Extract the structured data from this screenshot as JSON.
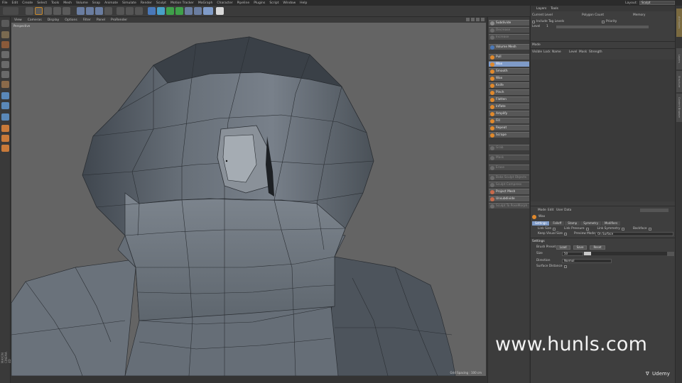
{
  "menubar": {
    "items": [
      "File",
      "Edit",
      "Create",
      "Select",
      "Tools",
      "Mesh",
      "Volume",
      "Snap",
      "Animate",
      "Simulate",
      "Render",
      "Sculpt",
      "Motion Tracker",
      "MoGraph",
      "Character",
      "Pipeline",
      "Plugins",
      "Script",
      "Window",
      "Help"
    ],
    "layout_label": "Layout:",
    "layout_value": "Sculpt"
  },
  "viewport": {
    "menu": [
      "View",
      "Cameras",
      "Display",
      "Options",
      "Filter",
      "Panel",
      "ProRender"
    ],
    "label": "Perspective",
    "grid_spacing": "Grid Spacing : 100 cm"
  },
  "sculpt_palette": {
    "top_items": [
      {
        "label": "Subdivide",
        "state": "normal",
        "icon": "subdivide-icon"
      },
      {
        "label": "Decrease",
        "state": "disabled",
        "icon": "decrease-icon"
      },
      {
        "label": "Increase",
        "state": "disabled",
        "icon": "increase-icon"
      },
      {
        "label": "Volume Mesh",
        "state": "normal",
        "icon": "volume-mesh-icon"
      }
    ],
    "brushes": [
      {
        "label": "Pull",
        "state": "normal",
        "color": "#e0892c"
      },
      {
        "label": "Wax",
        "state": "active",
        "color": "#e0892c"
      },
      {
        "label": "Smooth",
        "state": "normal",
        "color": "#e0892c"
      },
      {
        "label": "Wax",
        "state": "normal",
        "color": "#e0892c"
      },
      {
        "label": "Knife",
        "state": "normal",
        "color": "#e0892c"
      },
      {
        "label": "Pinch",
        "state": "normal",
        "color": "#e0892c"
      },
      {
        "label": "Flatten",
        "state": "normal",
        "color": "#e0892c"
      },
      {
        "label": "Inflate",
        "state": "normal",
        "color": "#e0892c"
      },
      {
        "label": "Amplify",
        "state": "normal",
        "color": "#e0892c"
      },
      {
        "label": "Fill",
        "state": "normal",
        "color": "#e0892c"
      },
      {
        "label": "Repeat",
        "state": "normal",
        "color": "#e0892c"
      },
      {
        "label": "Scrape",
        "state": "normal",
        "color": "#e0892c"
      }
    ],
    "lower_items": [
      {
        "label": "Grab",
        "state": "disabled"
      },
      {
        "label": "Mask",
        "state": "disabled"
      },
      {
        "label": "Erase",
        "state": "disabled"
      },
      {
        "label": "Bake Sculpt Objects",
        "state": "disabled"
      },
      {
        "label": "Sculpt Compress",
        "state": "disabled"
      },
      {
        "label": "Project Mesh",
        "state": "normal"
      },
      {
        "label": "Unsubdivide",
        "state": "normal"
      },
      {
        "label": "Sculpt To PoseMorph",
        "state": "disabled"
      }
    ]
  },
  "right_panel": {
    "tabs": [
      "Layers",
      "Tools"
    ],
    "layers_header": [
      "Current Level",
      "Polygon Count",
      "Memory"
    ],
    "options": [
      "Include Tag Levels",
      "Priority"
    ],
    "level_label": "Level",
    "level_value": "1",
    "mode_label": "Mode",
    "layer_columns": [
      "Visible",
      "Lock",
      "Name",
      "Level",
      "Mask",
      "Strength"
    ],
    "attributes": {
      "menu": [
        "Mode",
        "Edit",
        "User Data"
      ],
      "tool_name": "Wax",
      "tabs": [
        "Settings",
        "Falloff",
        "Stamp",
        "Symmetry",
        "Modifiers"
      ],
      "row_options": [
        "Link Size",
        "Link Pressure",
        "Link Symmetry",
        "Backface"
      ],
      "keep_visual_size": "Keep Visual Size",
      "preview_mode_label": "Preview Mode",
      "preview_mode_value": "On Surface",
      "settings_section": "Settings",
      "brush_preset": "Brush Preset",
      "load": "Load",
      "save": "Save",
      "reset": "Reset",
      "size_label": "Size",
      "size_value": "50",
      "direction_label": "Direction",
      "direction_value": "Normal",
      "surface_distance": "Surface Distance"
    }
  },
  "side_tabs": [
    "Attributes",
    "Layers",
    "Structure",
    "Content Browser"
  ],
  "brand_label": "MAXON CINEMA 4D",
  "watermark": "www.hunls.com",
  "udemy": "Udemy",
  "colors": {
    "accent": "#7f9bc8",
    "brush_icon": "#e0892c",
    "viewport_bg": "#646464",
    "panel_bg": "#3e3e3e"
  }
}
